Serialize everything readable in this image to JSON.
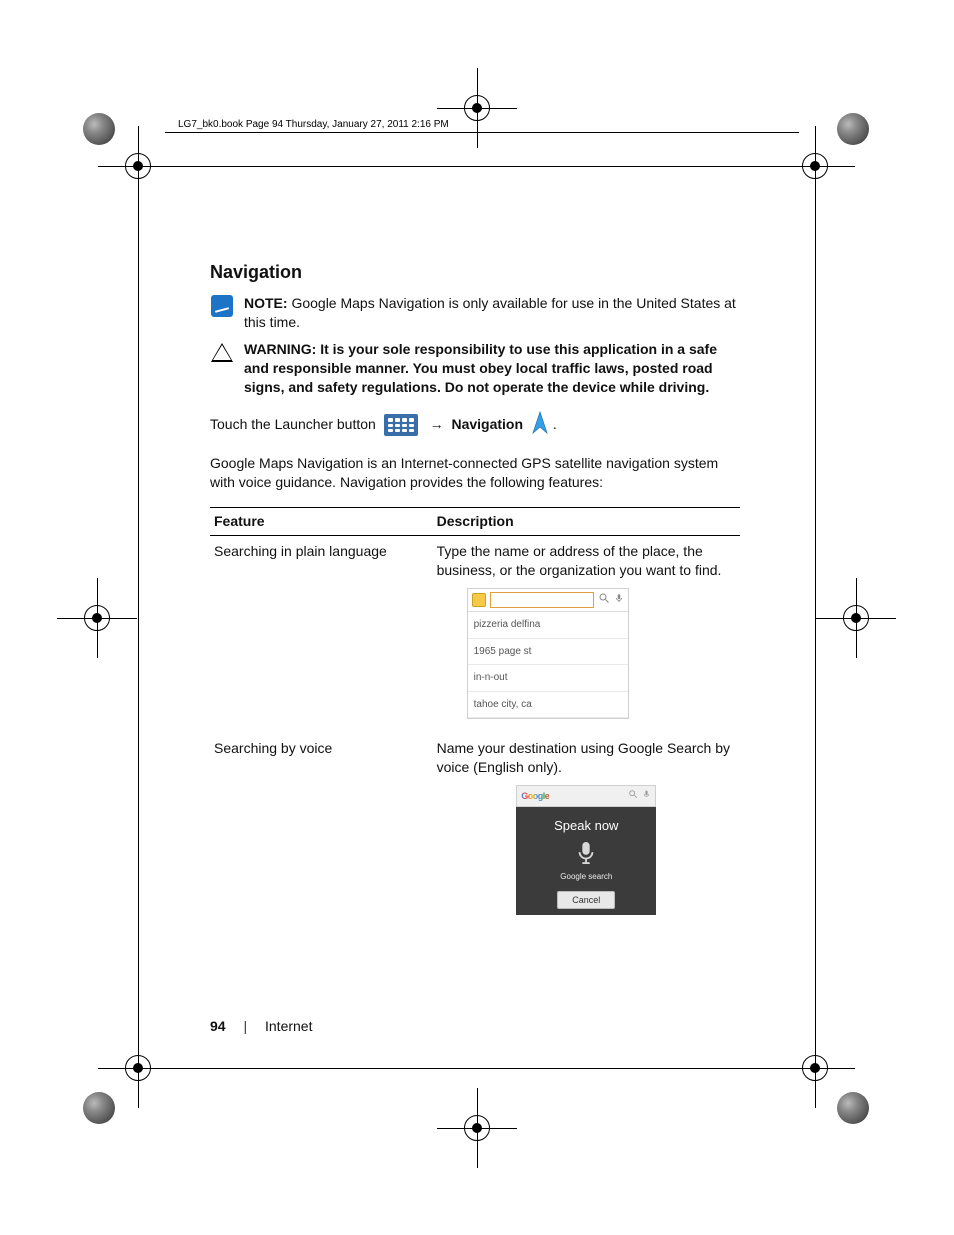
{
  "header_line": "LG7_bk0.book  Page 94  Thursday, January 27, 2011  2:16 PM",
  "section_title": "Navigation",
  "note": {
    "label": "NOTE:",
    "text": " Google Maps Navigation is only available for use in the United States at this time."
  },
  "warning": {
    "label": "WARNING:",
    "text": " It is your sole responsibility to use this application in a safe and responsible manner. You must obey local traffic laws, posted road signs, and safety regulations. Do not operate the device while driving."
  },
  "launcher": {
    "pre": "Touch the Launcher button ",
    "arrow": "→",
    "nav_word": "Navigation",
    "period": "."
  },
  "intro_para": "Google Maps Navigation is an Internet-connected GPS satellite navigation system with voice guidance. Navigation provides the following features:",
  "table": {
    "h1": "Feature",
    "h2": "Description",
    "row1": {
      "feature": "Searching in plain language",
      "desc": "Type the name or address of the place, the business, or the organization you want to find.",
      "suggestions": [
        "pizzeria delfina",
        "1965 page st",
        "in-n-out",
        "tahoe city, ca"
      ]
    },
    "row2": {
      "feature": "Searching by voice",
      "desc": "Name your destination using Google Search by voice (English only).",
      "speak": {
        "brand": "Google",
        "title": "Speak now",
        "subtitle": "Google search",
        "cancel": "Cancel"
      }
    }
  },
  "footer": {
    "page_number": "94",
    "section": "Internet"
  }
}
